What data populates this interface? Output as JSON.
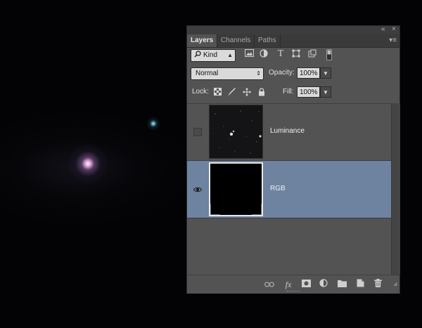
{
  "panel": {
    "collapse_glyph": "«",
    "close_glyph": "×",
    "menu_glyph": "▾≡",
    "tabs": [
      {
        "label": "Layers",
        "active": true
      },
      {
        "label": "Channels",
        "active": false
      },
      {
        "label": "Paths",
        "active": false
      }
    ],
    "filter": {
      "kind_label": "Kind",
      "kind_icon": "search-icon",
      "icons": [
        "image-filter-icon",
        "adjustment-filter-icon",
        "type-filter-icon",
        "shape-filter-icon",
        "smart-object-filter-icon",
        "filter-toggle-icon"
      ]
    },
    "blend": {
      "mode": "Normal",
      "opacity_label": "Opacity:",
      "opacity_value": "100%",
      "lock_label": "Lock:",
      "fill_label": "Fill:",
      "fill_value": "100%",
      "lock_icons": [
        "lock-transparent-icon",
        "lock-image-icon",
        "lock-position-icon",
        "lock-all-icon"
      ]
    },
    "layers": [
      {
        "name": "Luminance",
        "visible": false,
        "selected": false
      },
      {
        "name": "RGB",
        "visible": true,
        "selected": true
      }
    ],
    "bottom_icons": [
      "link-icon",
      "fx-icon",
      "mask-icon",
      "adjustment-icon",
      "group-folder-icon",
      "new-layer-icon",
      "trash-icon"
    ],
    "fx_label": "fx"
  },
  "colors": {
    "panel_bg": "#535353",
    "selected_layer": "#6e83a0",
    "canvas_bg": "#030305"
  }
}
